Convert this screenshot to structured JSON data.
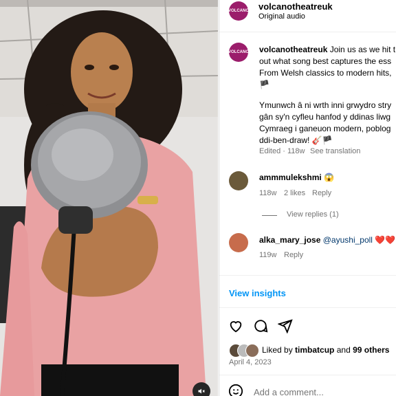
{
  "post": {
    "author": "volcanotheatreuk",
    "audio": "Original audio",
    "avatar_text": "VOLCANO",
    "caption_author": "volcanotheatreuk",
    "caption_lines": [
      "Join us as we hit t",
      "out what song best captures the ess",
      "From Welsh classics to modern hits,",
      "Ymunwch â ni wrth inni grwydro stry",
      "gân sy'n cyfleu hanfod y ddinas liwg",
      "Cymraeg i ganeuon modern, poblog",
      "ddi-ben-draw!"
    ],
    "caption_meta": "Edited · 118w",
    "see_translation": "See translation"
  },
  "comments": [
    {
      "author": "ammmulekshmi",
      "text": "😱",
      "age": "118w",
      "likes": "2 likes",
      "reply": "Reply",
      "view_replies": "View replies (1)"
    },
    {
      "author": "alka_mary_jose",
      "mention": "@ayushi_poll",
      "text": "❤️❤️",
      "age": "119w",
      "reply": "Reply"
    }
  ],
  "insights": "View insights",
  "likes": {
    "prefix": "Liked by",
    "user": "timbatcup",
    "and": "and",
    "count": "99 others"
  },
  "date": "April 4, 2023",
  "add_comment_placeholder": "Add a comment...",
  "colors": {
    "link": "#00376b",
    "insights": "#0095f6",
    "avatar": "#9b1d6b",
    "sweater": "#e9a2a3"
  },
  "icons": [
    "heart-icon",
    "comment-icon",
    "share-icon",
    "mute-icon",
    "emoji-icon",
    "flag-icon"
  ]
}
